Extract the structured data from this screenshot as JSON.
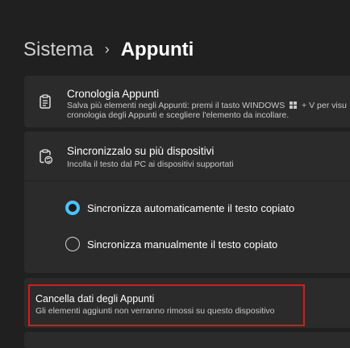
{
  "breadcrumb": {
    "parent": "Sistema",
    "separator": "›",
    "current": "Appunti"
  },
  "history": {
    "icon": "clipboard-list-icon",
    "title": "Cronologia Appunti",
    "description_line1": "Salva più elementi negli Appunti: premi il tasto WINDOWS",
    "windows_key_icon": "windows-logo-icon",
    "description_line1_suffix": "+ V per visu",
    "description_line2": "cronologia degli Appunti e scegliere l'elemento da incollare."
  },
  "sync": {
    "icon": "clipboard-sync-icon",
    "title": "Sincronizzalo su più dispositivi",
    "description": "Incolla il testo dal PC ai dispositivi supportati",
    "options": [
      {
        "label": "Sincronizza automaticamente il testo copiato",
        "selected": true
      },
      {
        "label": "Sincronizza manualmente il testo copiato",
        "selected": false
      }
    ]
  },
  "clear": {
    "title": "Cancella dati degli Appunti",
    "description": "Gli elementi aggiunti non verranno rimossi su questo dispositivo"
  },
  "colors": {
    "background": "#202020",
    "card": "#2b2b2b",
    "accent": "#4cc2ff",
    "highlight": "#e0161d"
  }
}
